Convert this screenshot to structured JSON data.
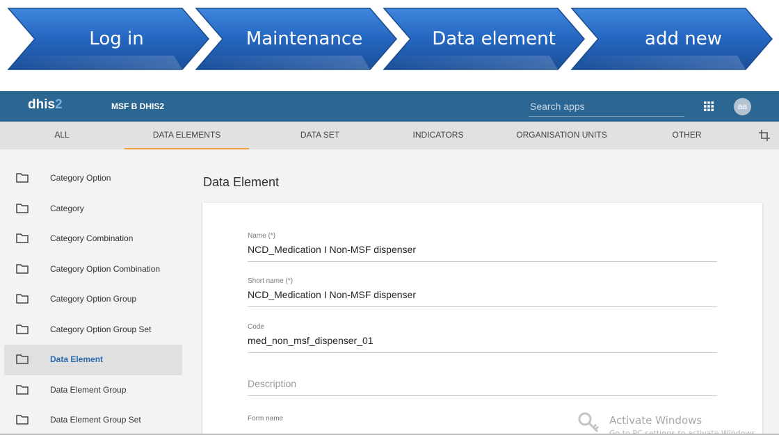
{
  "steps": [
    "Log in",
    "Maintenance",
    "Data element",
    "add new"
  ],
  "header": {
    "logo_main": "dhis",
    "logo_accent": "2",
    "instance_name": "MSF B DHIS2",
    "search_placeholder": "Search apps",
    "avatar_initials": "aa"
  },
  "tabs": [
    {
      "label": "ALL",
      "active": false
    },
    {
      "label": "DATA ELEMENTS",
      "active": true
    },
    {
      "label": "DATA SET",
      "active": false
    },
    {
      "label": "INDICATORS",
      "active": false
    },
    {
      "label": "ORGANISATION UNITS",
      "active": false
    },
    {
      "label": "OTHER",
      "active": false
    }
  ],
  "sidebar": {
    "items": [
      {
        "label": "Category Option",
        "active": false,
        "icon": "folder-icon"
      },
      {
        "label": "Category",
        "active": false,
        "icon": "folder-icon"
      },
      {
        "label": "Category Combination",
        "active": false,
        "icon": "folder-icon"
      },
      {
        "label": "Category Option Combination",
        "active": false,
        "icon": "folder-icon"
      },
      {
        "label": "Category Option Group",
        "active": false,
        "icon": "folder-icon"
      },
      {
        "label": "Category Option Group Set",
        "active": false,
        "icon": "folder-icon"
      },
      {
        "label": "Data Element",
        "active": true,
        "icon": "folder-icon"
      },
      {
        "label": "Data Element Group",
        "active": false,
        "icon": "folder-icon"
      },
      {
        "label": "Data Element Group Set",
        "active": false,
        "icon": "folder-icon"
      }
    ]
  },
  "main": {
    "title": "Data Element",
    "form": {
      "name_label": "Name (*)",
      "name_value": "NCD_Medication I Non-MSF dispenser",
      "short_name_label": "Short name (*)",
      "short_name_value": "NCD_Medication I Non-MSF dispenser",
      "code_label": "Code",
      "code_value": "med_non_msf_dispenser_01",
      "description_placeholder": "Description",
      "form_name_label": "Form name"
    }
  },
  "watermark": {
    "title": "Activate Windows",
    "subtitle": "Go to PC settings to activate Windows."
  },
  "colors": {
    "header_bg": "#2c6693",
    "tab_active_underline": "#f0a23a",
    "step_blue": "#2a6dc6",
    "active_link": "#2c6ab0"
  }
}
